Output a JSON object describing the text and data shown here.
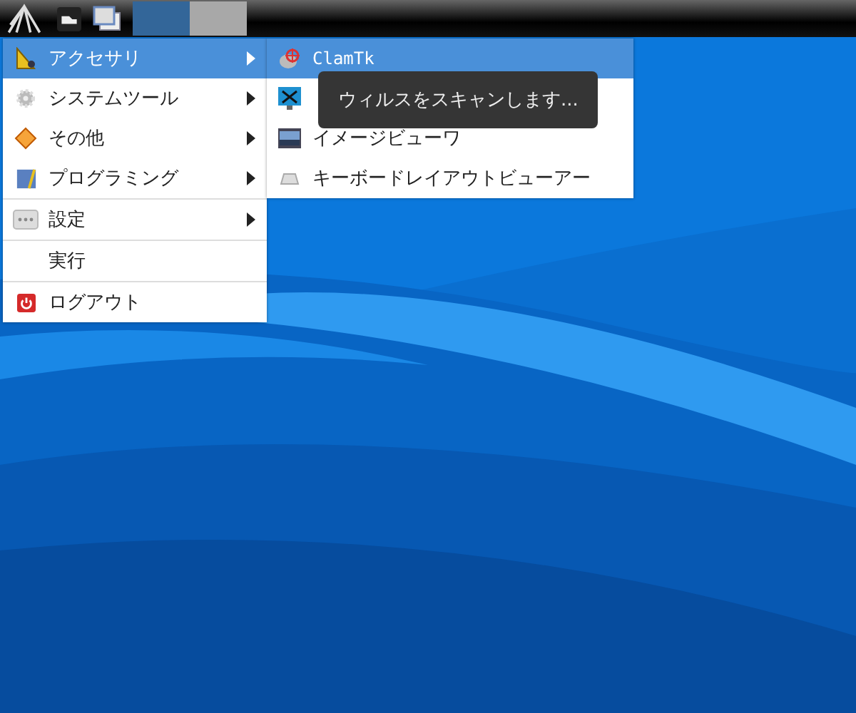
{
  "panel": {
    "tasks": [
      {
        "selected": true
      },
      {
        "selected": false
      }
    ]
  },
  "menu": {
    "groups": [
      [
        {
          "label": "アクセサリ",
          "has_submenu": true,
          "selected": true
        },
        {
          "label": "システムツール",
          "has_submenu": true,
          "selected": false
        },
        {
          "label": "その他",
          "has_submenu": true,
          "selected": false
        },
        {
          "label": "プログラミング",
          "has_submenu": true,
          "selected": false
        }
      ],
      [
        {
          "label": "設定",
          "has_submenu": true,
          "selected": false
        }
      ],
      [
        {
          "label": "実行",
          "has_submenu": false,
          "selected": false
        }
      ],
      [
        {
          "label": "ログアウト",
          "has_submenu": false,
          "selected": false
        }
      ]
    ]
  },
  "submenu": {
    "items": [
      {
        "label": "ClamTk",
        "selected": true
      },
      {
        "selected": false
      },
      {
        "label": "イメージビューワ",
        "selected": false
      },
      {
        "label": "キーボードレイアウトビューアー",
        "selected": false
      }
    ]
  },
  "tooltip": {
    "text": "ウィルスをスキャンします..."
  }
}
